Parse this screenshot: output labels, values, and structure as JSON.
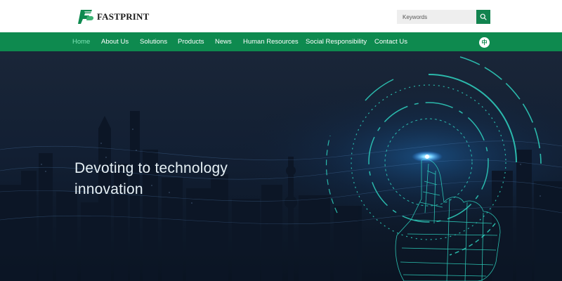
{
  "header": {
    "logo_text": "FASTPRINT",
    "logo_icon": "fastprint-logo-icon",
    "search": {
      "placeholder": "Keywords",
      "value": "",
      "button_icon": "search-icon"
    }
  },
  "nav": {
    "items": [
      {
        "label": "Home",
        "active": true
      },
      {
        "label": "About Us"
      },
      {
        "label": "Solutions"
      },
      {
        "label": "Products"
      },
      {
        "label": "News"
      },
      {
        "label": "Human Resources"
      },
      {
        "label": "Social Responsibility"
      },
      {
        "label": "Contact Us"
      }
    ],
    "language_toggle": "中"
  },
  "hero": {
    "headline_line1": "Devoting to technology",
    "headline_line2": "innovation"
  },
  "colors": {
    "brand_green": "#0e8a4f",
    "active_nav": "#7fe6b8",
    "hero_accent": "#2fd3c0"
  }
}
